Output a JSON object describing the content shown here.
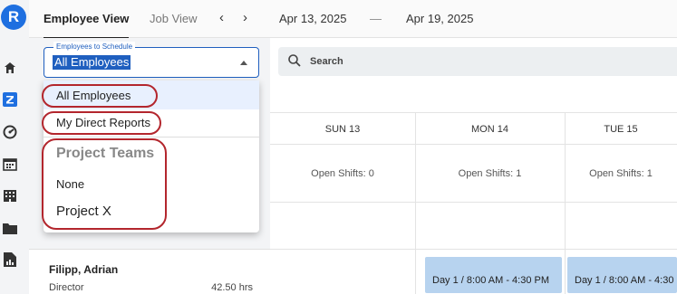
{
  "rail": {
    "logo_letter": "R",
    "icons": [
      "home-icon",
      "z-app-icon",
      "dashboard-icon",
      "calendar-icon",
      "building-icon",
      "folder-icon",
      "report-icon"
    ]
  },
  "topbar": {
    "tabs": [
      {
        "label": "Employee View",
        "active": true
      },
      {
        "label": "Job View",
        "active": false
      }
    ],
    "prev_arrow": "‹",
    "next_arrow": "›",
    "date_start": "Apr 13, 2025",
    "date_sep": "—",
    "date_end": "Apr 19, 2025"
  },
  "schedule_select": {
    "legend": "Employees to Schedule",
    "value": "All Employees"
  },
  "dropdown": {
    "items": [
      "All Employees",
      "My Direct Reports"
    ],
    "group_label": "Project Teams",
    "group_items": [
      "None",
      "Project X"
    ]
  },
  "search": {
    "placeholder": "Search"
  },
  "days": [
    {
      "label": "SUN 13",
      "open_shifts": "Open Shifts: 0"
    },
    {
      "label": "MON 14",
      "open_shifts": "Open Shifts: 1"
    },
    {
      "label": "TUE 15",
      "open_shifts": "Open Shifts: 1"
    }
  ],
  "employee": {
    "name": "Filipp, Adrian",
    "title": "Director",
    "hours": "42.50 hrs",
    "shifts": [
      "",
      "Day 1 / 8:00 AM - 4:30 PM",
      "Day 1 / 8:00 AM - 4:30"
    ]
  },
  "colors": {
    "accent": "#1f5fbf",
    "shift_fill": "#b7d3ef",
    "annotation": "#b3262d"
  }
}
